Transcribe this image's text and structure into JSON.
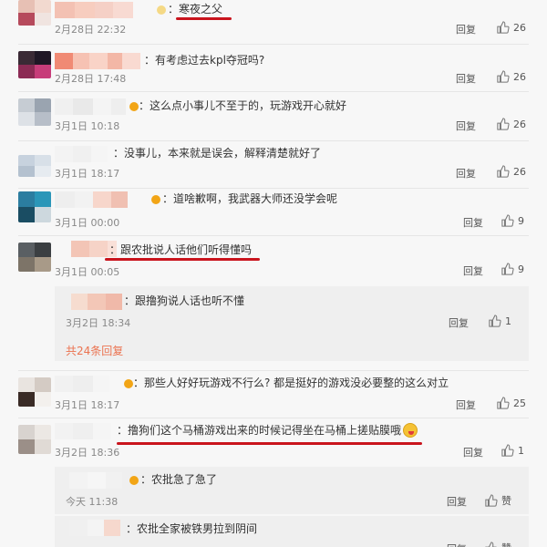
{
  "colors": {
    "accent": "#eb7350",
    "underline": "#c9141d",
    "vip": "#f2a516"
  },
  "icons": {
    "like": "thumbs-up-icon",
    "emoji": "grinning-emoji-icon",
    "vip": "vip-badge-icon"
  },
  "comments": [
    {
      "text": "：寒夜之父",
      "time": "2月28日 22:32",
      "reply": "回复",
      "likes": "26"
    },
    {
      "text": "：有考虑过去kpl夺冠吗?",
      "time": "2月28日 17:48",
      "reply": "回复",
      "likes": "26"
    },
    {
      "text": "：这么点小事儿不至于的，玩游戏开心就好",
      "time": "3月1日 10:18",
      "reply": "回复",
      "likes": "26"
    },
    {
      "text": "：没事儿，本来就是误会，解释清楚就好了",
      "time": "3月1日 18:17",
      "reply": "回复",
      "likes": "26"
    },
    {
      "text": "：道啥歉啊，我武器大师还没学会呢",
      "time": "3月1日 00:00",
      "reply": "回复",
      "likes": "9"
    },
    {
      "text": "：跟农批说人话他们听得懂吗",
      "time": "3月1日 00:05",
      "reply": "回复",
      "likes": "9"
    },
    {
      "text": "：那些人好好玩游戏不行么? 都是挺好的游戏没必要整的这么对立",
      "time": "3月1日 18:17",
      "reply": "回复",
      "likes": "25"
    },
    {
      "text": "：撸狗们这个马桶游戏出来的时候记得坐在马桶上搓贴膜哦",
      "time": "3月2日 18:36",
      "reply": "回复",
      "likes": "1"
    }
  ],
  "replies": [
    {
      "text": "：跟撸狗说人话也听不懂",
      "time": "3月2日 18:34",
      "reply": "回复",
      "likes": "1"
    },
    {
      "text": "：农批急了急了",
      "time": "今天 11:38",
      "reply": "回复",
      "likes": "赞"
    },
    {
      "text": "：农批全家被铁男拉到阴间",
      "time": "",
      "reply": "回复",
      "likes": "赞"
    }
  ],
  "more_replies": "共24条回复"
}
